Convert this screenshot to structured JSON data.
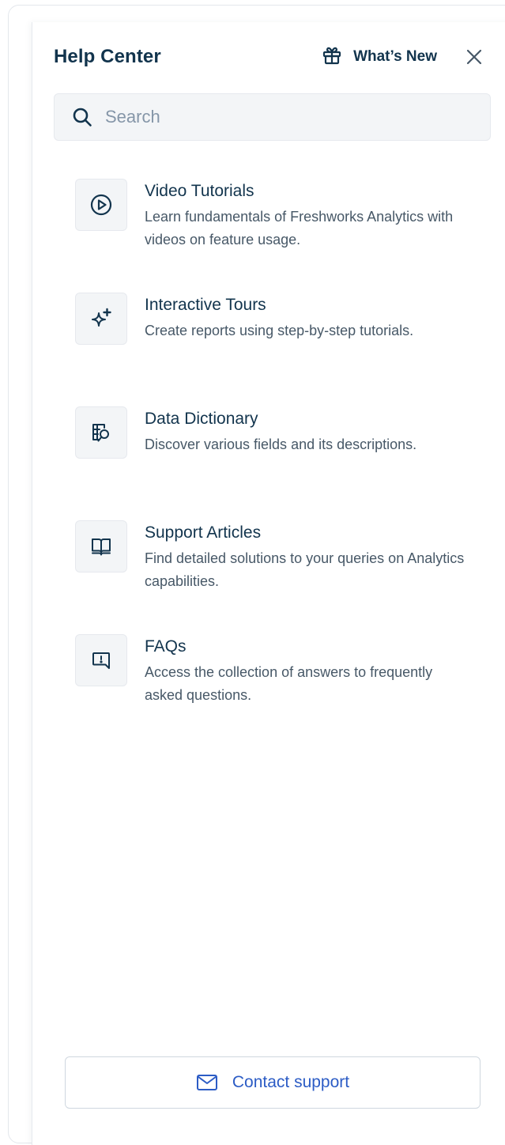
{
  "header": {
    "title": "Help Center",
    "whats_new_label": "What’s New",
    "whats_new_icon": "gift-icon",
    "close_icon": "close-icon"
  },
  "search": {
    "placeholder": "Search",
    "value": "",
    "icon": "search-icon"
  },
  "items": [
    {
      "icon": "play-circle-icon",
      "title": "Video Tutorials",
      "description": "Learn fundamentals of Freshworks Analytics with videos on feature usage."
    },
    {
      "icon": "sparkle-icon",
      "title": "Interactive Tours",
      "description": "Create reports using step-by-step tutorials."
    },
    {
      "icon": "table-search-icon",
      "title": "Data Dictionary",
      "description": "Discover various fields and its descriptions."
    },
    {
      "icon": "open-book-icon",
      "title": "Support Articles",
      "description": "Find detailed solutions to your queries on Analytics capabilities."
    },
    {
      "icon": "chat-alert-icon",
      "title": "FAQs",
      "description": "Access the collection of answers to frequently asked questions."
    }
  ],
  "footer": {
    "contact_label": "Contact support",
    "contact_icon": "mail-icon"
  },
  "colors": {
    "text_primary": "#12344d",
    "text_secondary": "#475867",
    "link": "#2c5cc5",
    "tile_bg": "#f3f5f7",
    "border": "#e6e9ee"
  }
}
